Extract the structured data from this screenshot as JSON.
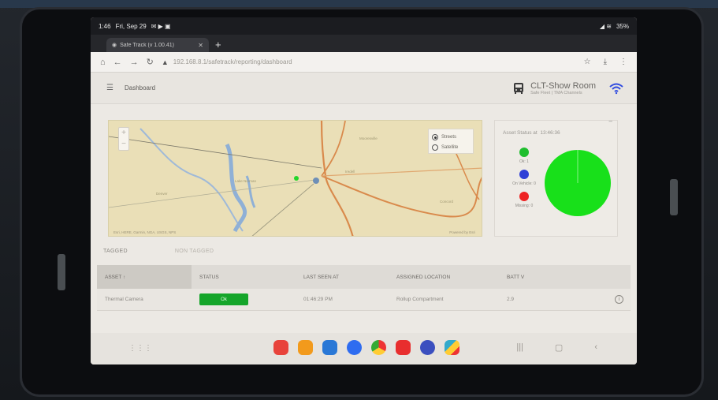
{
  "status_bar": {
    "time": "1:46",
    "date": "Fri, Sep 29",
    "battery": "35%"
  },
  "browser": {
    "tab_title": "Safe Track (v 1.00.41)",
    "new_tab_label": "+",
    "url": "192.168.8.1/safetrack/reporting/dashboard"
  },
  "header": {
    "page_title": "Dashboard",
    "location_name": "CLT-Show Room",
    "location_sub": "Safe Fleet | TMA Channels"
  },
  "map": {
    "layers": [
      "Streets",
      "Satellite"
    ],
    "selected_layer": "Streets",
    "zoom_in": "+",
    "zoom_out": "−",
    "attribution": "Esri, HERE, Garmin, NGA, USGS, NPS",
    "credit": "Powered by Esri",
    "place_labels": [
      "Lake Norman",
      "Mooresville",
      "Iredell",
      "Denver",
      "Concord"
    ]
  },
  "asset_status": {
    "title": "Asset Status at",
    "time": "13:46:36",
    "legend": [
      {
        "label": "Ok: 1",
        "color": "#1fbe2e"
      },
      {
        "label": "On Vehicle: 0",
        "color": "#2f3fd6"
      },
      {
        "label": "Missing: 0",
        "color": "#ee2222"
      }
    ],
    "pie_color": "#18e01a"
  },
  "asset_tabs": {
    "tagged": "TAGGED",
    "non_tagged": "NON TAGGED"
  },
  "table": {
    "headers": {
      "asset": "ASSET ↑",
      "status": "STATUS",
      "last_seen": "LAST SEEN AT",
      "assigned_location": "ASSIGNED LOCATION",
      "batt": "BATT V"
    },
    "rows": [
      {
        "asset": "Thermal Camera",
        "status": "Ok",
        "last_seen": "01:46:29 PM",
        "assigned_location": "Rollup Compartment",
        "batt": "2.9"
      }
    ]
  },
  "dock_apps": [
    {
      "name": "messages-app",
      "color": "#e8433b"
    },
    {
      "name": "notes-app",
      "color": "#f29a1c"
    },
    {
      "name": "gallery-app",
      "color": "#2a78d6"
    },
    {
      "name": "chat-app",
      "color": "#2e6cf0"
    },
    {
      "name": "chrome-app",
      "color": "#e0e0e0"
    },
    {
      "name": "youtube-app",
      "color": "#e82e2e"
    },
    {
      "name": "camera-app",
      "color": "#3b4fbf"
    },
    {
      "name": "play-store-app",
      "color": "#f6f6f6"
    }
  ]
}
